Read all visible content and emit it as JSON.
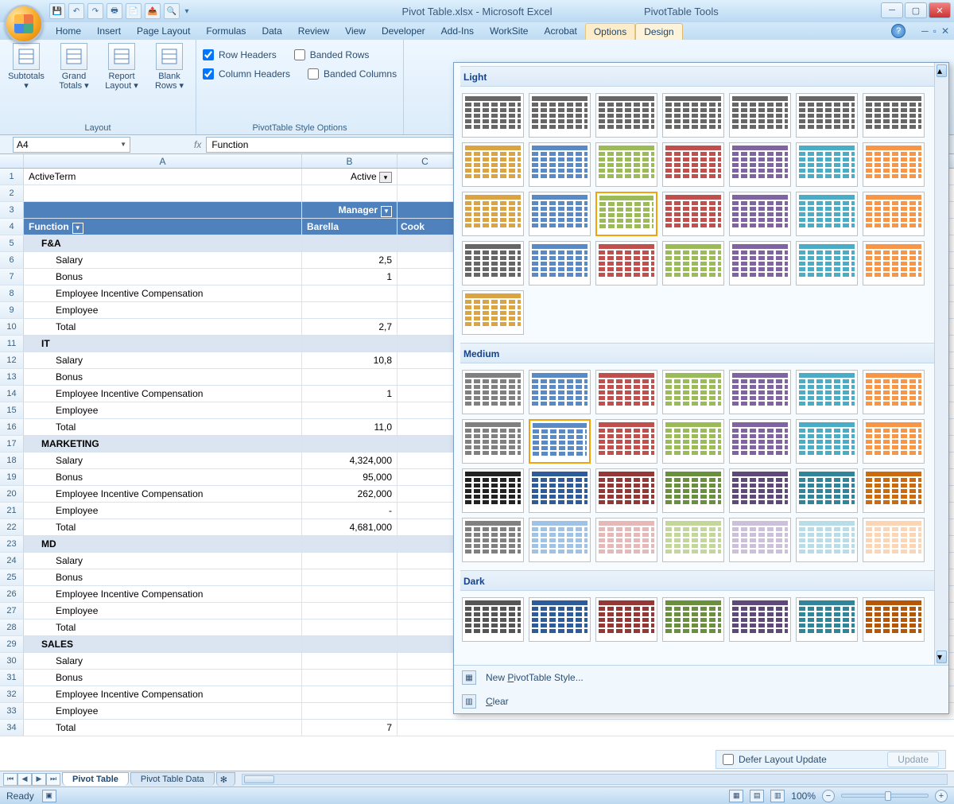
{
  "window": {
    "title": "Pivot Table.xlsx - Microsoft Excel",
    "tool_title": "PivotTable Tools"
  },
  "qat": [
    "save-icon",
    "undo-icon",
    "redo-icon",
    "print-icon",
    "preview-icon",
    "export-icon",
    "find-icon"
  ],
  "tabs": {
    "items": [
      "Home",
      "Insert",
      "Page Layout",
      "Formulas",
      "Data",
      "Review",
      "View",
      "Developer",
      "Add-Ins",
      "WorkSite",
      "Acrobat"
    ],
    "ctx": [
      "Options",
      "Design"
    ],
    "active": "Design"
  },
  "ribbon": {
    "layout_group": "Layout",
    "layout_btns": [
      {
        "label": "Subtotals",
        "drop": true
      },
      {
        "label": "Grand Totals",
        "drop": true
      },
      {
        "label": "Report Layout",
        "drop": true
      },
      {
        "label": "Blank Rows",
        "drop": true
      }
    ],
    "options_group": "PivotTable Style Options",
    "opts": {
      "row_headers": "Row Headers",
      "col_headers": "Column Headers",
      "banded_rows": "Banded Rows",
      "banded_cols": "Banded Columns"
    }
  },
  "namebox": "A4",
  "fx": "fx",
  "formula": "Function",
  "columns": [
    "A",
    "B",
    "C"
  ],
  "pivot": {
    "active_term_label": "ActiveTerm",
    "active_term_val": "Active",
    "mgr": "Manager",
    "func": "Function",
    "barella": "Barella",
    "cook": "Cook",
    "rows": [
      {
        "n": 5,
        "t": "sub",
        "a": "F&A"
      },
      {
        "n": 6,
        "t": "d",
        "a": "Salary",
        "b": "2,5"
      },
      {
        "n": 7,
        "t": "d",
        "a": "Bonus",
        "b": "1"
      },
      {
        "n": 8,
        "t": "d",
        "a": "Employee Incentive Compensation"
      },
      {
        "n": 9,
        "t": "d",
        "a": "Employee"
      },
      {
        "n": 10,
        "t": "d",
        "a": "Total",
        "b": "2,7"
      },
      {
        "n": 11,
        "t": "sub",
        "a": "IT"
      },
      {
        "n": 12,
        "t": "d",
        "a": "Salary",
        "b": "10,8"
      },
      {
        "n": 13,
        "t": "d",
        "a": "Bonus"
      },
      {
        "n": 14,
        "t": "d",
        "a": "Employee Incentive Compensation",
        "b": "1"
      },
      {
        "n": 15,
        "t": "d",
        "a": "Employee"
      },
      {
        "n": 16,
        "t": "d",
        "a": "Total",
        "b": "11,0"
      },
      {
        "n": 17,
        "t": "sub",
        "a": "MARKETING"
      },
      {
        "n": 18,
        "t": "d",
        "a": "Salary",
        "b": "4,324,000"
      },
      {
        "n": 19,
        "t": "d",
        "a": "Bonus",
        "b": "95,000"
      },
      {
        "n": 20,
        "t": "d",
        "a": "Employee Incentive Compensation",
        "b": "262,000"
      },
      {
        "n": 21,
        "t": "d",
        "a": "Employee",
        "b": "-"
      },
      {
        "n": 22,
        "t": "d",
        "a": "Total",
        "b": "4,681,000"
      },
      {
        "n": 23,
        "t": "sub",
        "a": "MD"
      },
      {
        "n": 24,
        "t": "d",
        "a": "Salary"
      },
      {
        "n": 25,
        "t": "d",
        "a": "Bonus"
      },
      {
        "n": 26,
        "t": "d",
        "a": "Employee Incentive Compensation"
      },
      {
        "n": 27,
        "t": "d",
        "a": "Employee"
      },
      {
        "n": 28,
        "t": "d",
        "a": "Total"
      },
      {
        "n": 29,
        "t": "sub",
        "a": "SALES"
      },
      {
        "n": 30,
        "t": "d",
        "a": "Salary"
      },
      {
        "n": 31,
        "t": "d",
        "a": "Bonus"
      },
      {
        "n": 32,
        "t": "d",
        "a": "Employee Incentive Compensation"
      },
      {
        "n": 33,
        "t": "d",
        "a": "Employee"
      },
      {
        "n": 34,
        "t": "d",
        "a": "Total",
        "b": "7"
      }
    ]
  },
  "gallery": {
    "sections": [
      "Light",
      "Medium",
      "Dark"
    ],
    "light_colors": [
      [
        "#666",
        "#666",
        "#666",
        "#666",
        "#666",
        "#666",
        "#666"
      ],
      [
        "#d9a441",
        "#5a8ac6",
        "#9bbb59",
        "#c0504d",
        "#8064a2",
        "#4bacc6",
        "#f79646"
      ],
      [
        "#d9a441",
        "#5a8ac6",
        "#9bbb59",
        "#c0504d",
        "#8064a2",
        "#4bacc6",
        "#f79646"
      ],
      [
        "#666",
        "#5a8ac6",
        "#c0504d",
        "#9bbb59",
        "#8064a2",
        "#4bacc6",
        "#f79646"
      ],
      [
        "#d9a441"
      ]
    ],
    "light_selected": 16,
    "medium_colors": [
      [
        "#808080",
        "#5a8ac6",
        "#c0504d",
        "#9bbb59",
        "#8064a2",
        "#4bacc6",
        "#f79646"
      ],
      [
        "#808080",
        "#5a8ac6",
        "#c0504d",
        "#9bbb59",
        "#8064a2",
        "#4bacc6",
        "#f79646"
      ],
      [
        "#222",
        "#2e5b9a",
        "#953734",
        "#6a8f3f",
        "#5f497a",
        "#31859b",
        "#cc6a10"
      ],
      [
        "#808080",
        "#9ec3e6",
        "#e6b8b7",
        "#c4d79b",
        "#ccc0da",
        "#b7dee8",
        "#fcd5b4"
      ]
    ],
    "medium_selected": 8,
    "dark_colors": [
      [
        "#555",
        "#2e5b9a",
        "#953734",
        "#6a8f3f",
        "#5f497a",
        "#31859b",
        "#b65708"
      ]
    ],
    "cmd_new": "New PivotTable Style...",
    "cmd_clear": "Clear"
  },
  "sheets": {
    "tabs": [
      "Pivot Table",
      "Pivot Table Data"
    ],
    "active": 0
  },
  "defer": {
    "label": "Defer Layout Update",
    "btn": "Update"
  },
  "status": {
    "ready": "Ready",
    "zoom": "100%"
  }
}
